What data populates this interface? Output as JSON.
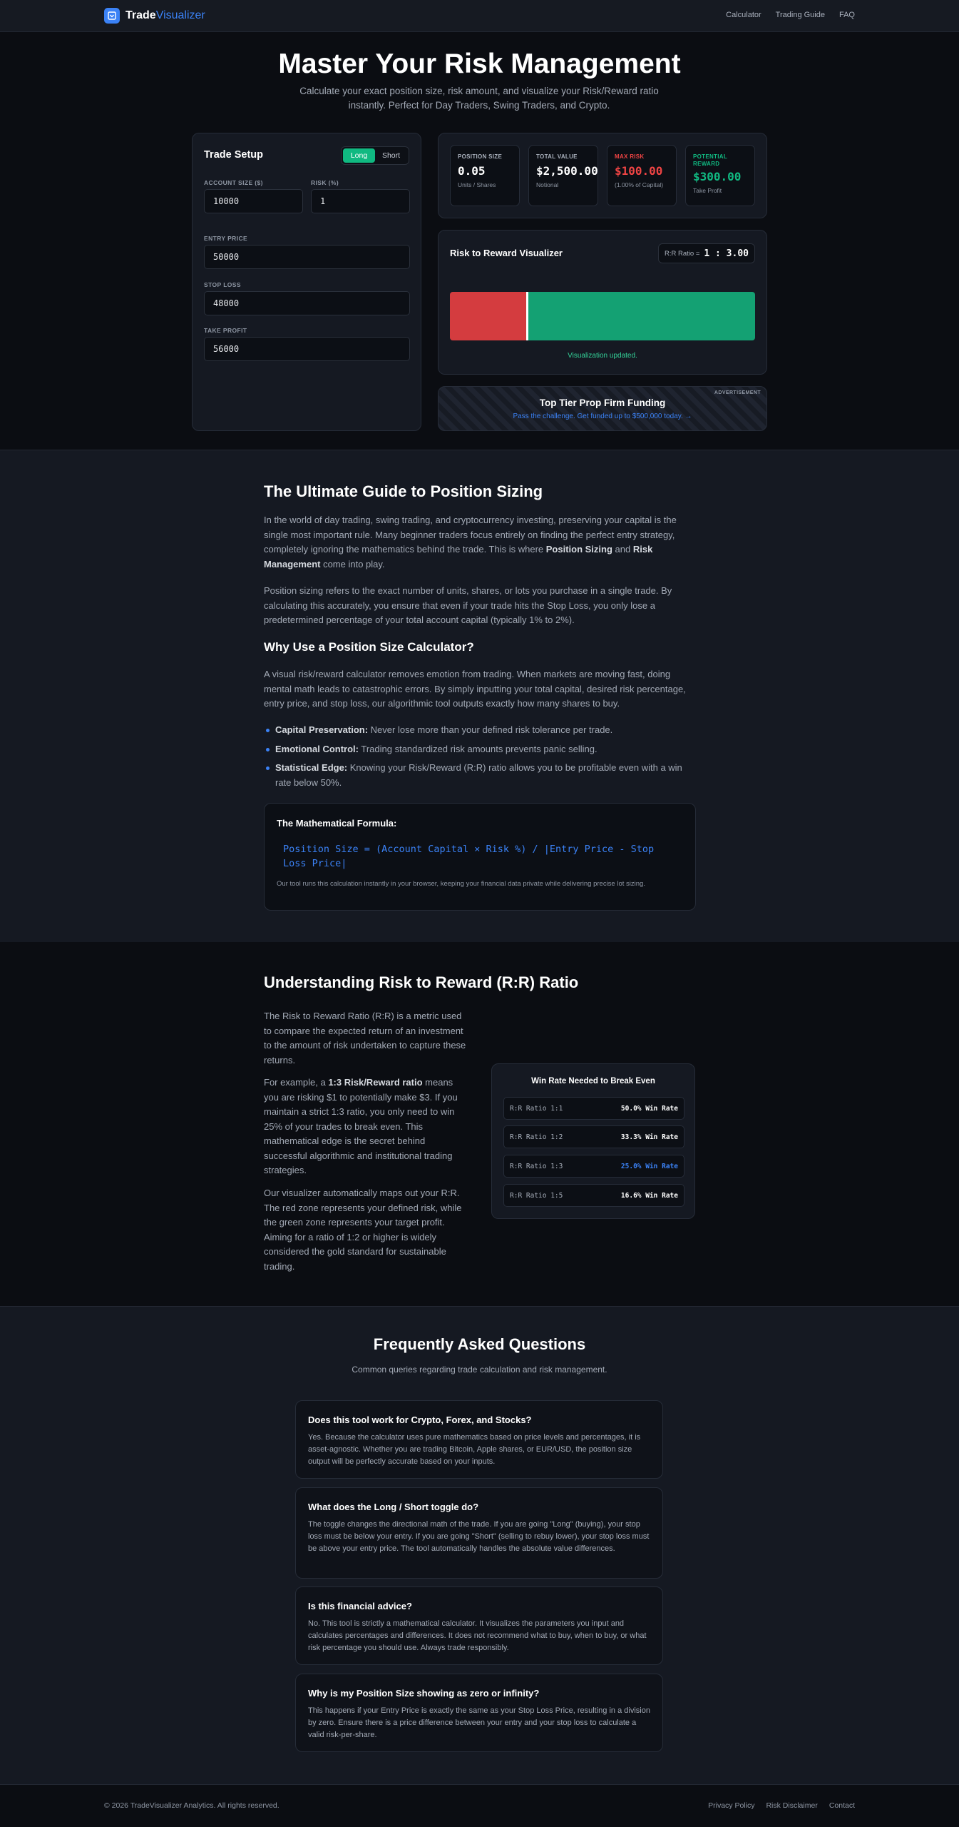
{
  "nav": {
    "brand_main": "Trade",
    "brand_accent": "Visualizer",
    "links": [
      "Calculator",
      "Trading Guide",
      "FAQ"
    ]
  },
  "hero": {
    "title": "Master Your Risk Management",
    "subtitle": "Calculate your exact position size, risk amount, and visualize your Risk/Reward ratio instantly. Perfect for Day Traders, Swing Traders, and Crypto."
  },
  "setup": {
    "title": "Trade Setup",
    "direction_options": [
      "Long",
      "Short"
    ],
    "direction_selected": "Long",
    "account_size_label": "ACCOUNT SIZE ($)",
    "account_size": "10000",
    "risk_label": "RISK (%)",
    "risk": "1",
    "entry_label": "ENTRY PRICE",
    "entry": "50000",
    "stop_label": "STOP LOSS",
    "stop": "48000",
    "take_label": "TAKE PROFIT",
    "take": "56000"
  },
  "stats": {
    "position_size": {
      "label": "POSITION SIZE",
      "value": "0.05",
      "sub": "Units / Shares"
    },
    "total_value": {
      "label": "TOTAL VALUE",
      "value": "$2,500.00",
      "sub": "Notional"
    },
    "max_risk": {
      "label": "MAX RISK",
      "value": "$100.00",
      "sub": "(1.00% of Capital)"
    },
    "potential_reward": {
      "label": "POTENTIAL REWARD",
      "value": "$300.00",
      "sub": "Take Profit"
    }
  },
  "colors": {
    "risk": "#d43c3f",
    "reward": "#14a173",
    "accent": "#3b82f6",
    "long_active": "#10b981"
  },
  "visualizer": {
    "title": "Risk to Reward Visualizer",
    "ratio_label": "R:R Ratio =",
    "ratio_value": "1 : 3.00",
    "risk_fraction": 0.25,
    "status": "Visualization updated."
  },
  "ad": {
    "tag": "ADVERTISEMENT",
    "title": "Top Tier Prop Firm Funding",
    "link": "Pass the challenge. Get funded up to $500,000 today. →"
  },
  "guide": {
    "title": "The Ultimate Guide to Position Sizing",
    "p1_a": "In the world of day trading, swing trading, and cryptocurrency investing, preserving your capital is the single most important rule. Many beginner traders focus entirely on finding the perfect entry strategy, completely ignoring the mathematics behind the trade. This is where ",
    "p1_b1": "Position Sizing",
    "p1_c": " and ",
    "p1_b2": "Risk Management",
    "p1_d": " come into play.",
    "p2": "Position sizing refers to the exact number of units, shares, or lots you purchase in a single trade. By calculating this accurately, you ensure that even if your trade hits the Stop Loss, you only lose a predetermined percentage of your total account capital (typically 1% to 2%).",
    "why_title": "Why Use a Position Size Calculator?",
    "p3": "A visual risk/reward calculator removes emotion from trading. When markets are moving fast, doing mental math leads to catastrophic errors. By simply inputting your total capital, desired risk percentage, entry price, and stop loss, our algorithmic tool outputs exactly how many shares to buy.",
    "bullets": [
      {
        "bold": "Capital Preservation:",
        "text": " Never lose more than your defined risk tolerance per trade."
      },
      {
        "bold": "Emotional Control:",
        "text": " Trading standardized risk amounts prevents panic selling."
      },
      {
        "bold": "Statistical Edge:",
        "text": " Knowing your Risk/Reward (R:R) ratio allows you to be profitable even with a win rate below 50%."
      }
    ],
    "formula_title": "The Mathematical Formula:",
    "formula": "Position Size = (Account Capital × Risk %) / |Entry Price - Stop Loss Price|",
    "formula_note": "Our tool runs this calculation instantly in your browser, keeping your financial data private while delivering precise lot sizing."
  },
  "rr_section": {
    "title": "Understanding Risk to Reward (R:R) Ratio",
    "p1": "The Risk to Reward Ratio (R:R) is a metric used to compare the expected return of an investment to the amount of risk undertaken to capture these returns.",
    "p2_a": "For example, a ",
    "p2_b": "1:3 Risk/Reward ratio",
    "p2_c": " means you are risking $1 to potentially make $3. If you maintain a strict 1:3 ratio, you only need to win 25% of your trades to break even. This mathematical edge is the secret behind successful algorithmic and institutional trading strategies.",
    "p3": "Our visualizer automatically maps out your R:R. The red zone represents your defined risk, while the green zone represents your target profit. Aiming for a ratio of 1:2 or higher is widely considered the gold standard for sustainable trading.",
    "table_title": "Win Rate Needed to Break Even",
    "rows": [
      {
        "name": "R:R Ratio 1:1",
        "value": "50.0% Win Rate"
      },
      {
        "name": "R:R Ratio 1:2",
        "value": "33.3% Win Rate"
      },
      {
        "name": "R:R Ratio 1:3",
        "value": "25.0% Win Rate"
      },
      {
        "name": "R:R Ratio 1:5",
        "value": "16.6% Win Rate"
      }
    ]
  },
  "faq": {
    "title": "Frequently Asked Questions",
    "subtitle": "Common queries regarding trade calculation and risk management.",
    "items": [
      {
        "q": "Does this tool work for Crypto, Forex, and Stocks?",
        "a": "Yes. Because the calculator uses pure mathematics based on price levels and percentages, it is asset-agnostic. Whether you are trading Bitcoin, Apple shares, or EUR/USD, the position size output will be perfectly accurate based on your inputs."
      },
      {
        "q": "What does the Long / Short toggle do?",
        "a": "The toggle changes the directional math of the trade. If you are going \"Long\" (buying), your stop loss must be below your entry. If you are going \"Short\" (selling to rebuy lower), your stop loss must be above your entry price. The tool automatically handles the absolute value differences."
      },
      {
        "q": "Is this financial advice?",
        "a": "No. This tool is strictly a mathematical calculator. It visualizes the parameters you input and calculates percentages and differences. It does not recommend what to buy, when to buy, or what risk percentage you should use. Always trade responsibly."
      },
      {
        "q": "Why is my Position Size showing as zero or infinity?",
        "a": "This happens if your Entry Price is exactly the same as your Stop Loss Price, resulting in a division by zero. Ensure there is a price difference between your entry and your stop loss to calculate a valid risk-per-share."
      }
    ]
  },
  "footer": {
    "copyright": "© 2026 TradeVisualizer Analytics. All rights reserved.",
    "links": [
      "Privacy Policy",
      "Risk Disclaimer",
      "Contact"
    ]
  }
}
